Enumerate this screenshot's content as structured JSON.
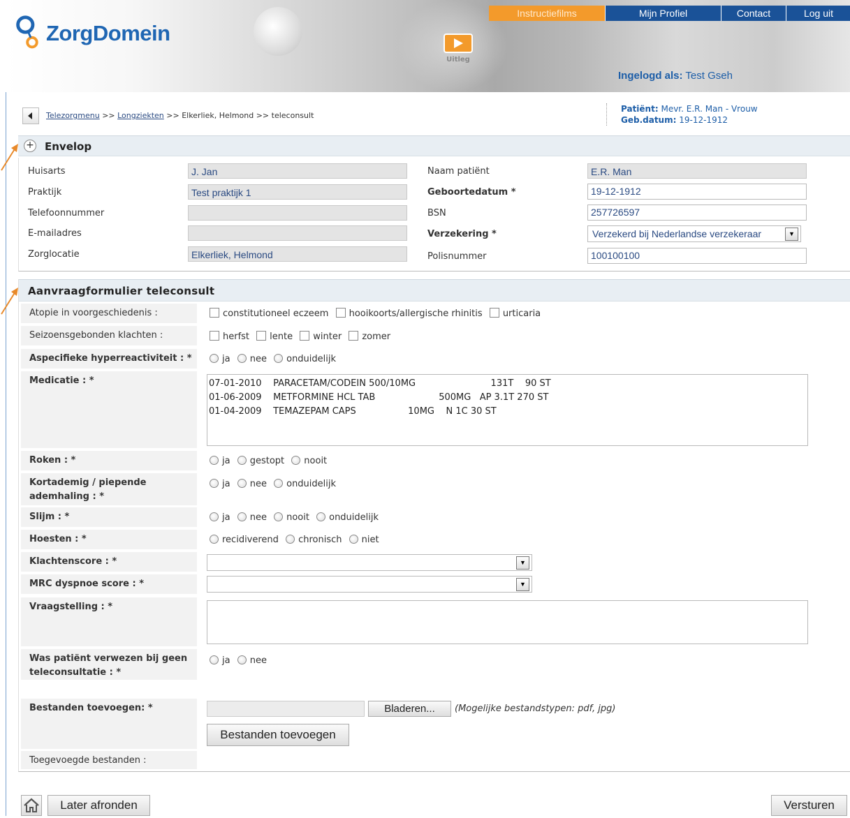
{
  "brand": {
    "name": "ZorgDomein"
  },
  "nav": {
    "items": [
      "Instructiefilms",
      "Mijn Profiel",
      "Contact",
      "Log uit"
    ]
  },
  "video": {
    "label": "Uitleg"
  },
  "login": {
    "prefix": "Ingelogd als:",
    "user": "Test Gseh"
  },
  "breadcrumb": {
    "items": [
      "Telezorgmenu",
      "Longziekten",
      "Elkerliek, Helmond",
      "teleconsult"
    ],
    "separator": ">>"
  },
  "patient": {
    "label": "Patiënt:",
    "value": "Mevr. E.R. Man - Vrouw",
    "dob_label": "Geb.datum:",
    "dob": "19-12-1912"
  },
  "envelop": {
    "title": "Envelop",
    "left": [
      {
        "label": "Huisarts",
        "value": "J. Jan"
      },
      {
        "label": "Praktijk",
        "value": "Test praktijk 1"
      },
      {
        "label": "Telefoonnummer",
        "value": ""
      },
      {
        "label": "E-mailadres",
        "value": ""
      },
      {
        "label": "Zorglocatie",
        "value": "Elkerliek, Helmond"
      }
    ],
    "right": [
      {
        "label": "Naam patiënt",
        "value": "E.R. Man"
      },
      {
        "label": "Geboortedatum *",
        "value": "19-12-1912"
      },
      {
        "label": "BSN",
        "value": "257726597"
      },
      {
        "label": "Verzekering *",
        "value": "Verzekerd bij Nederlandse verzekeraar"
      },
      {
        "label": "Polisnummer",
        "value": "100100100"
      }
    ]
  },
  "form": {
    "title": "Aanvraagformulier teleconsult",
    "atopie": {
      "label": "Atopie in voorgeschiedenis :",
      "options": [
        "constitutioneel eczeem",
        "hooikoorts/allergische rhinitis",
        "urticaria"
      ]
    },
    "seizoen": {
      "label": "Seizoensgebonden klachten :",
      "options": [
        "herfst",
        "lente",
        "winter",
        "zomer"
      ]
    },
    "hyper": {
      "label": "Aspecifieke hyperreactiviteit : *",
      "options": [
        "ja",
        "nee",
        "onduidelijk"
      ]
    },
    "medicatie": {
      "label": "Medicatie : *",
      "lines": [
        "07-01-2010    PARACETAM/CODEIN 500/10MG                          131T    90 ST",
        "01-06-2009    METFORMINE HCL TAB                      500MG   AP 3.1T 270 ST",
        "01-04-2009    TEMAZEPAM CAPS                  10MG    N 1C 30 ST"
      ]
    },
    "roken": {
      "label": "Roken : *",
      "options": [
        "ja",
        "gestopt",
        "nooit"
      ]
    },
    "kortademig": {
      "label": "Kortademig / piepende ademhaling : *",
      "options": [
        "ja",
        "nee",
        "onduidelijk"
      ]
    },
    "slijm": {
      "label": "Slijm : *",
      "options": [
        "ja",
        "nee",
        "nooit",
        "onduidelijk"
      ]
    },
    "hoesten": {
      "label": "Hoesten : *",
      "options": [
        "recidiverend",
        "chronisch",
        "niet"
      ]
    },
    "klachtenscore": {
      "label": "Klachtenscore : *",
      "value": ""
    },
    "mrc": {
      "label": "MRC dyspnoe score : *",
      "value": ""
    },
    "vraagstelling": {
      "label": "Vraagstelling : *",
      "value": ""
    },
    "verwezen": {
      "label": "Was patiënt verwezen bij geen teleconsultatie : *",
      "options": [
        "ja",
        "nee"
      ]
    },
    "bestanden": {
      "label": "Bestanden toevoegen: *",
      "browse": "Bladeren...",
      "hint": "(Mogelijke bestandstypen: pdf, jpg)",
      "add_button": "Bestanden toevoegen"
    },
    "toegevoegd": {
      "label": "Toegevoegde bestanden :"
    }
  },
  "footer": {
    "later": "Later afronden",
    "send": "Versturen"
  },
  "colors": {
    "nav_orange": "#f39a2b",
    "nav_blue": "#1a5298",
    "brand_blue": "#1f66b3",
    "arrow_orange": "#e88a2b"
  }
}
